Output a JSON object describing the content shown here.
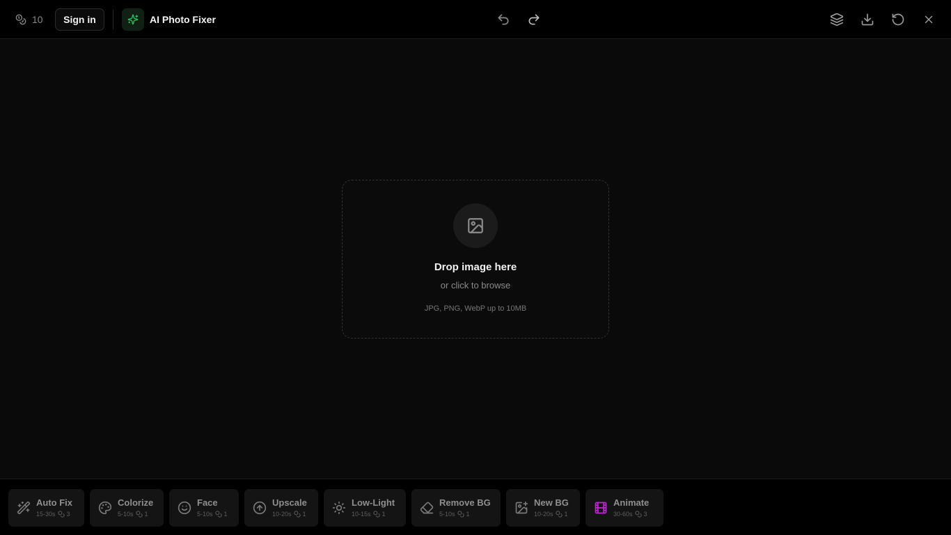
{
  "header": {
    "credits": "10",
    "signin_label": "Sign in",
    "app_name": "AI Photo Fixer",
    "brand_color": "#22c55e"
  },
  "dropzone": {
    "title": "Drop image here",
    "subtitle": "or click to browse",
    "note": "JPG, PNG, WebP up to 10MB"
  },
  "tools": [
    {
      "name": "Auto Fix",
      "time": "15-30s",
      "cost": "3",
      "icon": "magic-wand-icon"
    },
    {
      "name": "Colorize",
      "time": "5-10s",
      "cost": "1",
      "icon": "palette-icon"
    },
    {
      "name": "Face",
      "time": "5-10s",
      "cost": "1",
      "icon": "smile-icon"
    },
    {
      "name": "Upscale",
      "time": "10-20s",
      "cost": "1",
      "icon": "arrow-up-circle-icon"
    },
    {
      "name": "Low-Light",
      "time": "10-15s",
      "cost": "1",
      "icon": "sun-icon"
    },
    {
      "name": "Remove BG",
      "time": "5-10s",
      "cost": "1",
      "icon": "eraser-icon"
    },
    {
      "name": "New BG",
      "time": "10-20s",
      "cost": "1",
      "icon": "image-plus-icon"
    },
    {
      "name": "Animate",
      "time": "30-60s",
      "cost": "3",
      "icon": "film-icon",
      "accent": "#c026d3"
    }
  ]
}
